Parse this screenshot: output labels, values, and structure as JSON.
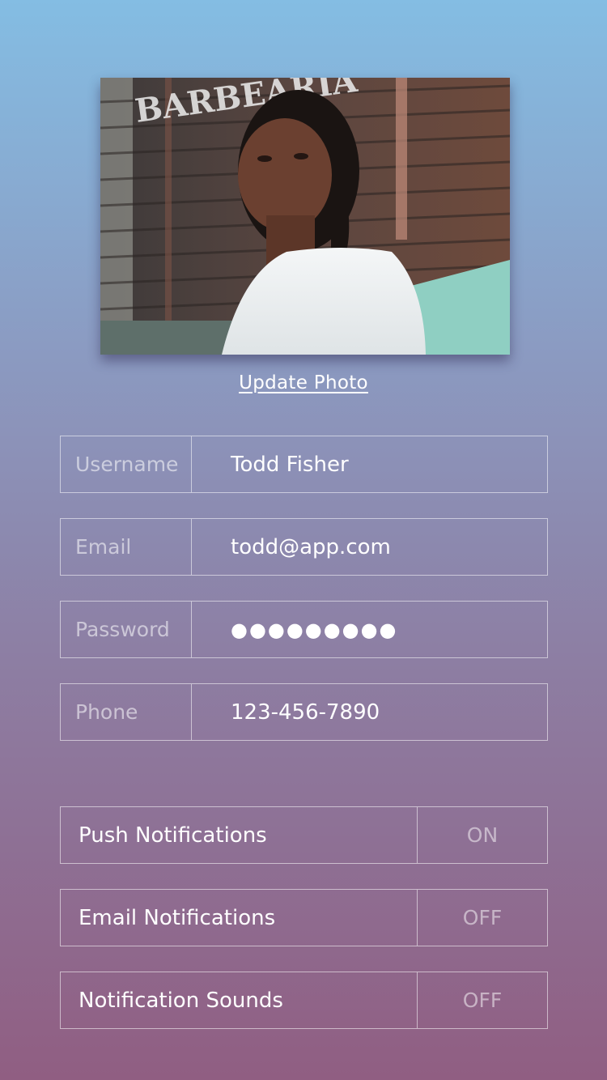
{
  "profile": {
    "update_photo_label": "Update Photo"
  },
  "fields": [
    {
      "label": "Username",
      "value": "Todd Fisher"
    },
    {
      "label": "Email",
      "value": "todd@app.com"
    },
    {
      "label": "Password",
      "value": "●●●●●●●●●"
    },
    {
      "label": "Phone",
      "value": "123-456-7890"
    }
  ],
  "toggles": [
    {
      "label": "Push Notifications",
      "state": "ON"
    },
    {
      "label": "Email Notifications",
      "state": "OFF"
    },
    {
      "label": "Notification Sounds",
      "state": "OFF"
    }
  ],
  "colors": {
    "gradient_top": "#84bde3",
    "gradient_bottom": "#905e82"
  }
}
